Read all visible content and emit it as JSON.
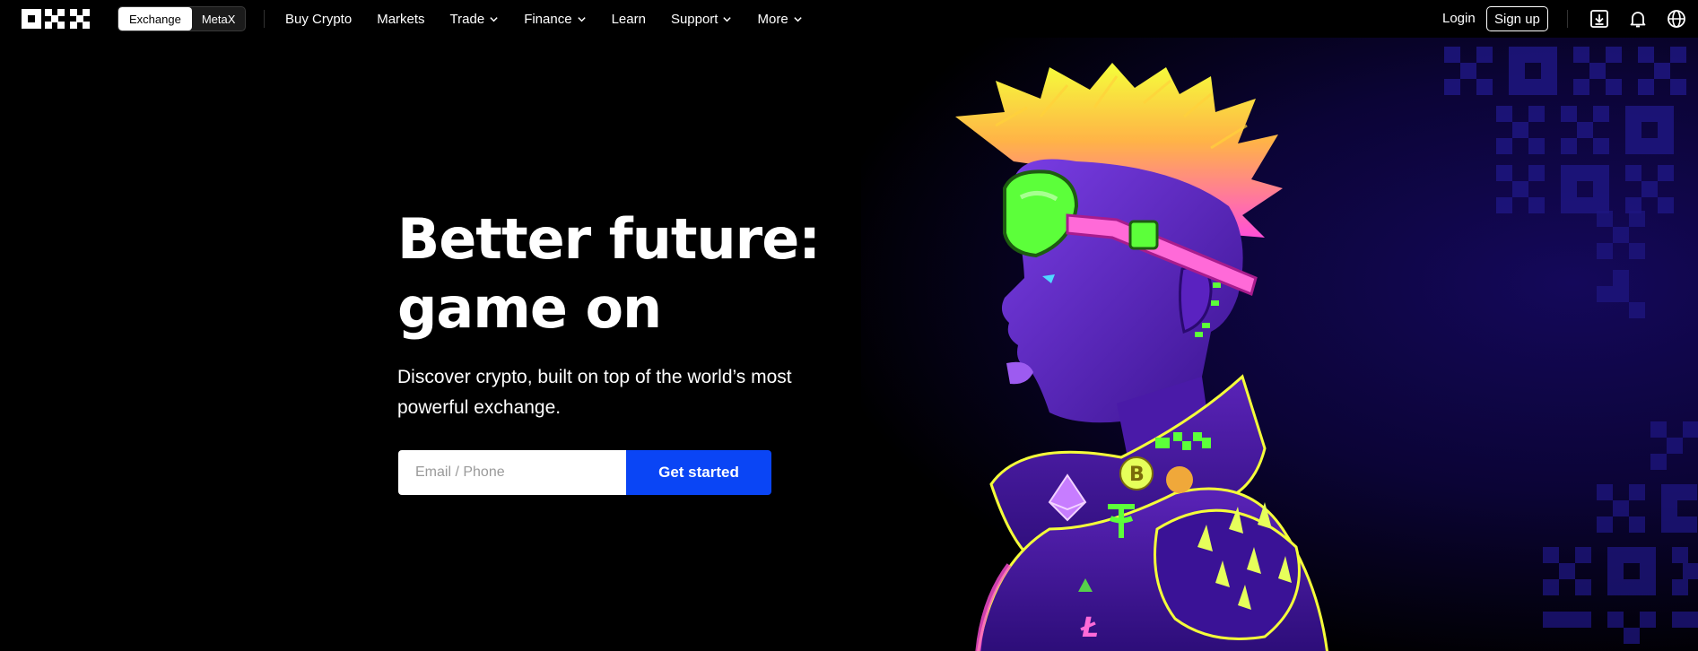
{
  "nav": {
    "logo_text": "OKX",
    "switch": {
      "exchange": "Exchange",
      "metax": "MetaX"
    },
    "menu": [
      {
        "label": "Buy Crypto",
        "dropdown": false
      },
      {
        "label": "Markets",
        "dropdown": false
      },
      {
        "label": "Trade",
        "dropdown": true
      },
      {
        "label": "Finance",
        "dropdown": true
      },
      {
        "label": "Learn",
        "dropdown": false
      },
      {
        "label": "Support",
        "dropdown": true
      },
      {
        "label": "More",
        "dropdown": true
      }
    ],
    "login": "Login",
    "signup": "Sign up",
    "icons": [
      "download-icon",
      "bell-icon",
      "globe-icon"
    ]
  },
  "hero": {
    "headline_line1": "Better future:",
    "headline_line2": "game on",
    "subtitle": "Discover crypto, built on top of the world’s most powerful exchange.",
    "email_placeholder": "Email / Phone",
    "cta_label": "Get started"
  },
  "colors": {
    "background": "#000000",
    "cta_blue": "#0a45f5",
    "art_purple": "#6a2fd0",
    "neon_green": "#5cff3a",
    "neon_pink": "#ff4fd8",
    "neon_yellow": "#f5ff3a"
  }
}
